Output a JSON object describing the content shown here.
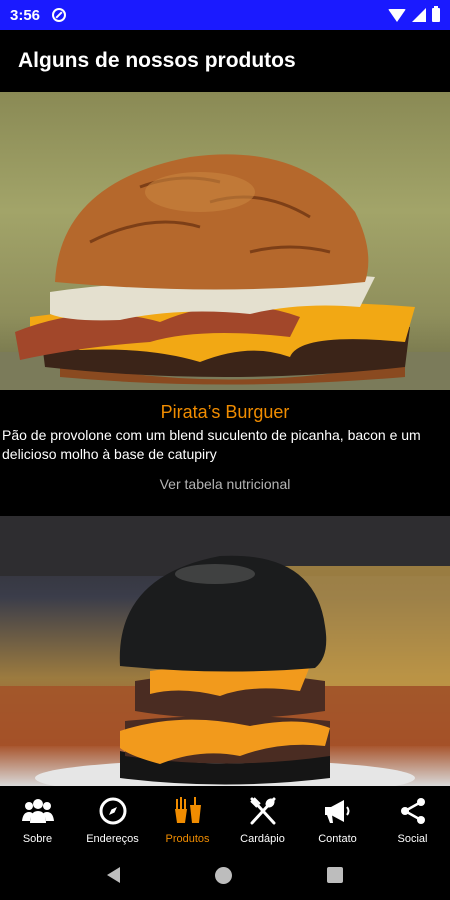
{
  "status_bar": {
    "time": "3:56"
  },
  "header": {
    "title": "Alguns de nossos produtos"
  },
  "products": [
    {
      "name": "Pirata’s Burguer",
      "description": "Pão de provolone com um blend suculento de picanha, bacon e um delicioso molho à base de catupiry",
      "link_label": "Ver tabela nutricional"
    }
  ],
  "bottom_nav": {
    "items": [
      {
        "label": "Sobre",
        "icon": "people-icon"
      },
      {
        "label": "Endereços",
        "icon": "compass-icon"
      },
      {
        "label": "Produtos",
        "icon": "fries-drink-icon",
        "active": true
      },
      {
        "label": "Cardápio",
        "icon": "utensils-icon"
      },
      {
        "label": "Contato",
        "icon": "megaphone-icon"
      },
      {
        "label": "Social",
        "icon": "share-icon"
      }
    ],
    "active_color": "#f08c00"
  },
  "colors": {
    "status_bar": "#1a1aff",
    "accent": "#f08c00",
    "background": "#000000"
  }
}
